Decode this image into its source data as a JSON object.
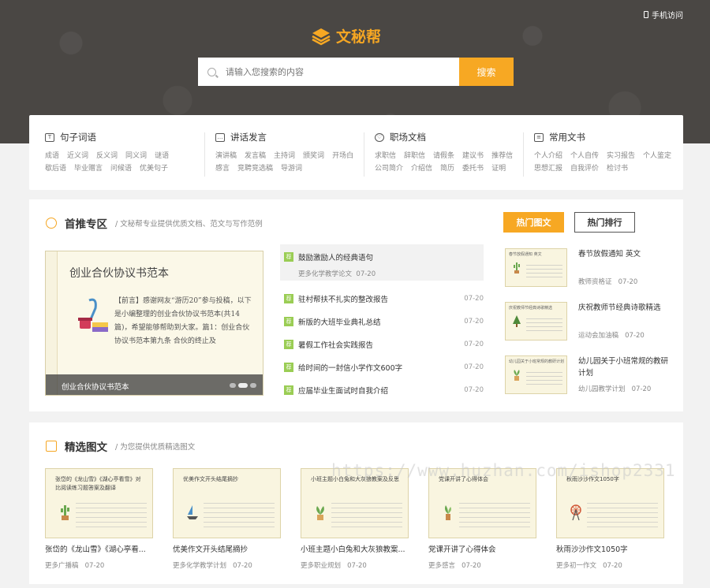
{
  "header": {
    "mobile_link": "手机访问",
    "logo_text": "文秘帮",
    "brand_color": "#f7a823"
  },
  "search": {
    "placeholder": "请输入您搜索的内容",
    "button": "搜索"
  },
  "categories": [
    {
      "title": "句子词语",
      "icon": "text-icon",
      "links": [
        "成语",
        "近义词",
        "反义词",
        "同义词",
        "谜语",
        "歇后语",
        "毕业赠言",
        "问候语",
        "优美句子"
      ]
    },
    {
      "title": "讲话发言",
      "icon": "speech-icon",
      "links": [
        "演讲稿",
        "发言稿",
        "主持词",
        "颁奖词",
        "开场白",
        "感言",
        "竞聘竞选稿",
        "导游词"
      ]
    },
    {
      "title": "职场文档",
      "icon": "handshake-icon",
      "links": [
        "求职信",
        "辞职信",
        "请假条",
        "建议书",
        "推荐信",
        "公司简介",
        "介绍信",
        "简历",
        "委托书",
        "证明"
      ]
    },
    {
      "title": "常用文书",
      "icon": "document-icon",
      "links": [
        "个人介绍",
        "个人自传",
        "实习报告",
        "个人鉴定",
        "思想汇报",
        "自我评价",
        "检讨书"
      ]
    }
  ],
  "featured": {
    "title": "首推专区",
    "subtitle": "/ 文秘帮专业提供优质文档、范文与写作范例",
    "tab_hot": "热门图文",
    "tab_rank": "热门排行",
    "slide": {
      "title": "创业合伙协议书范本",
      "text": "【前言】感谢网友“游历20”参与投稿，以下是小编整理的创业合伙协议书范本(共14篇)，希望能够帮助到大家。篇1：创业合伙协议书范本第九条 合伙的终止及",
      "caption": "创业合伙协议书范本"
    },
    "top_news": {
      "badge": "荐",
      "title": "鼓励激励人的经典语句",
      "meta": "更多化学教学论文",
      "date": "07-20"
    },
    "news": [
      {
        "badge": "荐",
        "title": "驻村帮扶不扎实的整改报告",
        "date": "07-20"
      },
      {
        "badge": "荐",
        "title": "新版的大班毕业典礼总结",
        "date": "07-20"
      },
      {
        "badge": "荐",
        "title": "暑假工作社会实践报告",
        "date": "07-20"
      },
      {
        "badge": "荐",
        "title": "给时间的一封信小学作文600字",
        "date": "07-20"
      },
      {
        "badge": "荐",
        "title": "应届毕业生面试时自我介绍",
        "date": "07-20"
      }
    ],
    "hot": [
      {
        "thumb": "春节放假通知 英文",
        "title": "春节放假通知 英文",
        "meta": "教师资格证",
        "date": "07-20"
      },
      {
        "thumb": "庆祝教师节经典诗歌精选",
        "title": "庆祝教师节经典诗歌精选",
        "meta": "运动会加油稿",
        "date": "07-20"
      },
      {
        "thumb": "幼儿园关于小班常规的教研计划",
        "title": "幼儿园关于小班常规的教研计划",
        "meta": "幼儿园教学计划",
        "date": "07-20"
      }
    ]
  },
  "picks": {
    "title": "精选图文",
    "subtitle": "/ 为您提供优质精选图文",
    "items": [
      {
        "thumb": "张岱的《龙山雪》《湖心亭看雪》对比阅读练习题答案及翻译",
        "title": "张岱的《龙山雪》《湖心亭看...",
        "meta": "更多广播稿",
        "date": "07-20"
      },
      {
        "thumb": "优美作文开头结尾摘抄",
        "title": "优美作文开头结尾摘抄",
        "meta": "更多化学教学计划",
        "date": "07-20"
      },
      {
        "thumb": "小班主题小白兔和大灰狼教案及反思",
        "title": "小班主题小白兔和大灰狼教案...",
        "meta": "更多职业规划",
        "date": "07-20"
      },
      {
        "thumb": "党课开讲了心得体会",
        "title": "党课开讲了心得体会",
        "meta": "更多感言",
        "date": "07-20"
      },
      {
        "thumb": "秋雨沙沙作文1050字",
        "title": "秋雨沙沙作文1050字",
        "meta": "更多初一作文",
        "date": "07-20"
      }
    ]
  },
  "watermark": "https://www.huzhan.com/ishop2331"
}
